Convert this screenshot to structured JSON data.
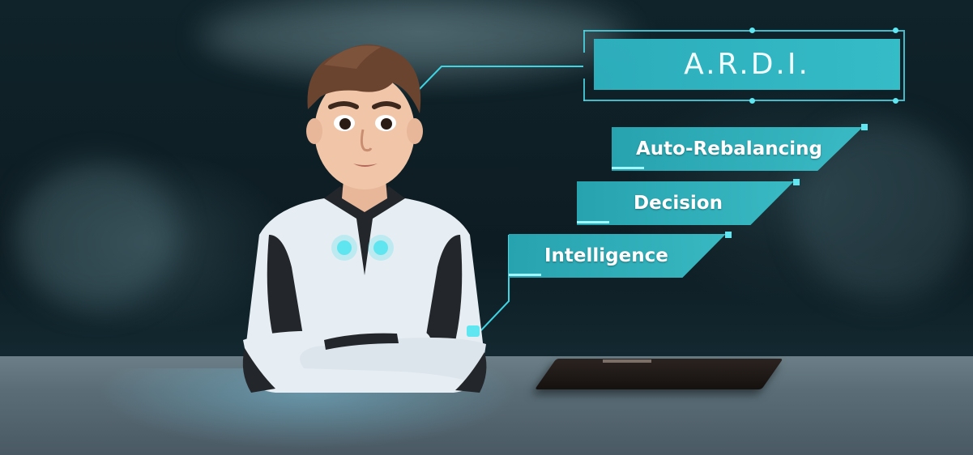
{
  "title": "A.R.D.I.",
  "tags": [
    {
      "label": "Auto-Rebalancing"
    },
    {
      "label": "Decision"
    },
    {
      "label": "Intelligence"
    }
  ],
  "colors": {
    "accent": "#36c4d0",
    "glow": "#5fe6f0",
    "suit_white": "#e6edf3",
    "suit_black": "#23272b"
  }
}
